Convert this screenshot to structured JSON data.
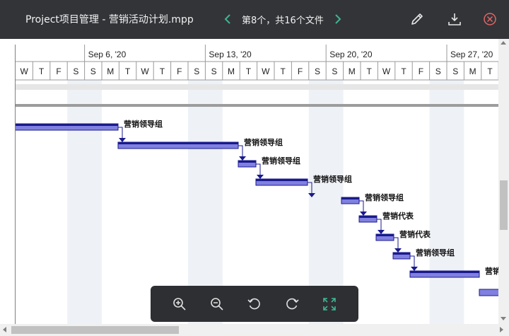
{
  "titlebar": {
    "file_title": "Project项目管理 - 营销活动计划.mpp",
    "pager_text": "第8个，共16个文件",
    "icons": {
      "prev": "chevron-left-icon",
      "next": "chevron-right-icon",
      "edit": "pencil-icon",
      "download": "download-icon",
      "close": "close-circle-icon"
    },
    "colors": {
      "background": "#333438",
      "chevron": "#3fb68f",
      "close": "#e06666"
    }
  },
  "gantt": {
    "week_labels": [
      "Sep 6, '20",
      "Sep 13, '20",
      "Sep 20, '20",
      "Sep 27, '20"
    ],
    "day_letters": [
      "W",
      "T",
      "F",
      "S",
      "S",
      "M",
      "T",
      "W",
      "T",
      "F",
      "S",
      "S",
      "M",
      "T",
      "W",
      "T",
      "F",
      "S",
      "S",
      "M",
      "T",
      "W",
      "T",
      "F",
      "S",
      "S",
      "M",
      "T"
    ],
    "task_labels": [
      "营销领导组",
      "营销领导组",
      "营销领导组",
      "营销领导组",
      "营销领导组",
      "营销代表",
      "营销代表",
      "营销领导组",
      "营销领导组"
    ],
    "colors": {
      "bar": "#1a1a8c",
      "bar_light": "#8080e0",
      "weekend": "#eef1f6",
      "grid": "#9a9a9a"
    }
  },
  "zoom_toolbar": {
    "icons": [
      "zoom-in-icon",
      "zoom-out-icon",
      "rotate-left-icon",
      "rotate-right-icon",
      "fullscreen-icon"
    ]
  }
}
